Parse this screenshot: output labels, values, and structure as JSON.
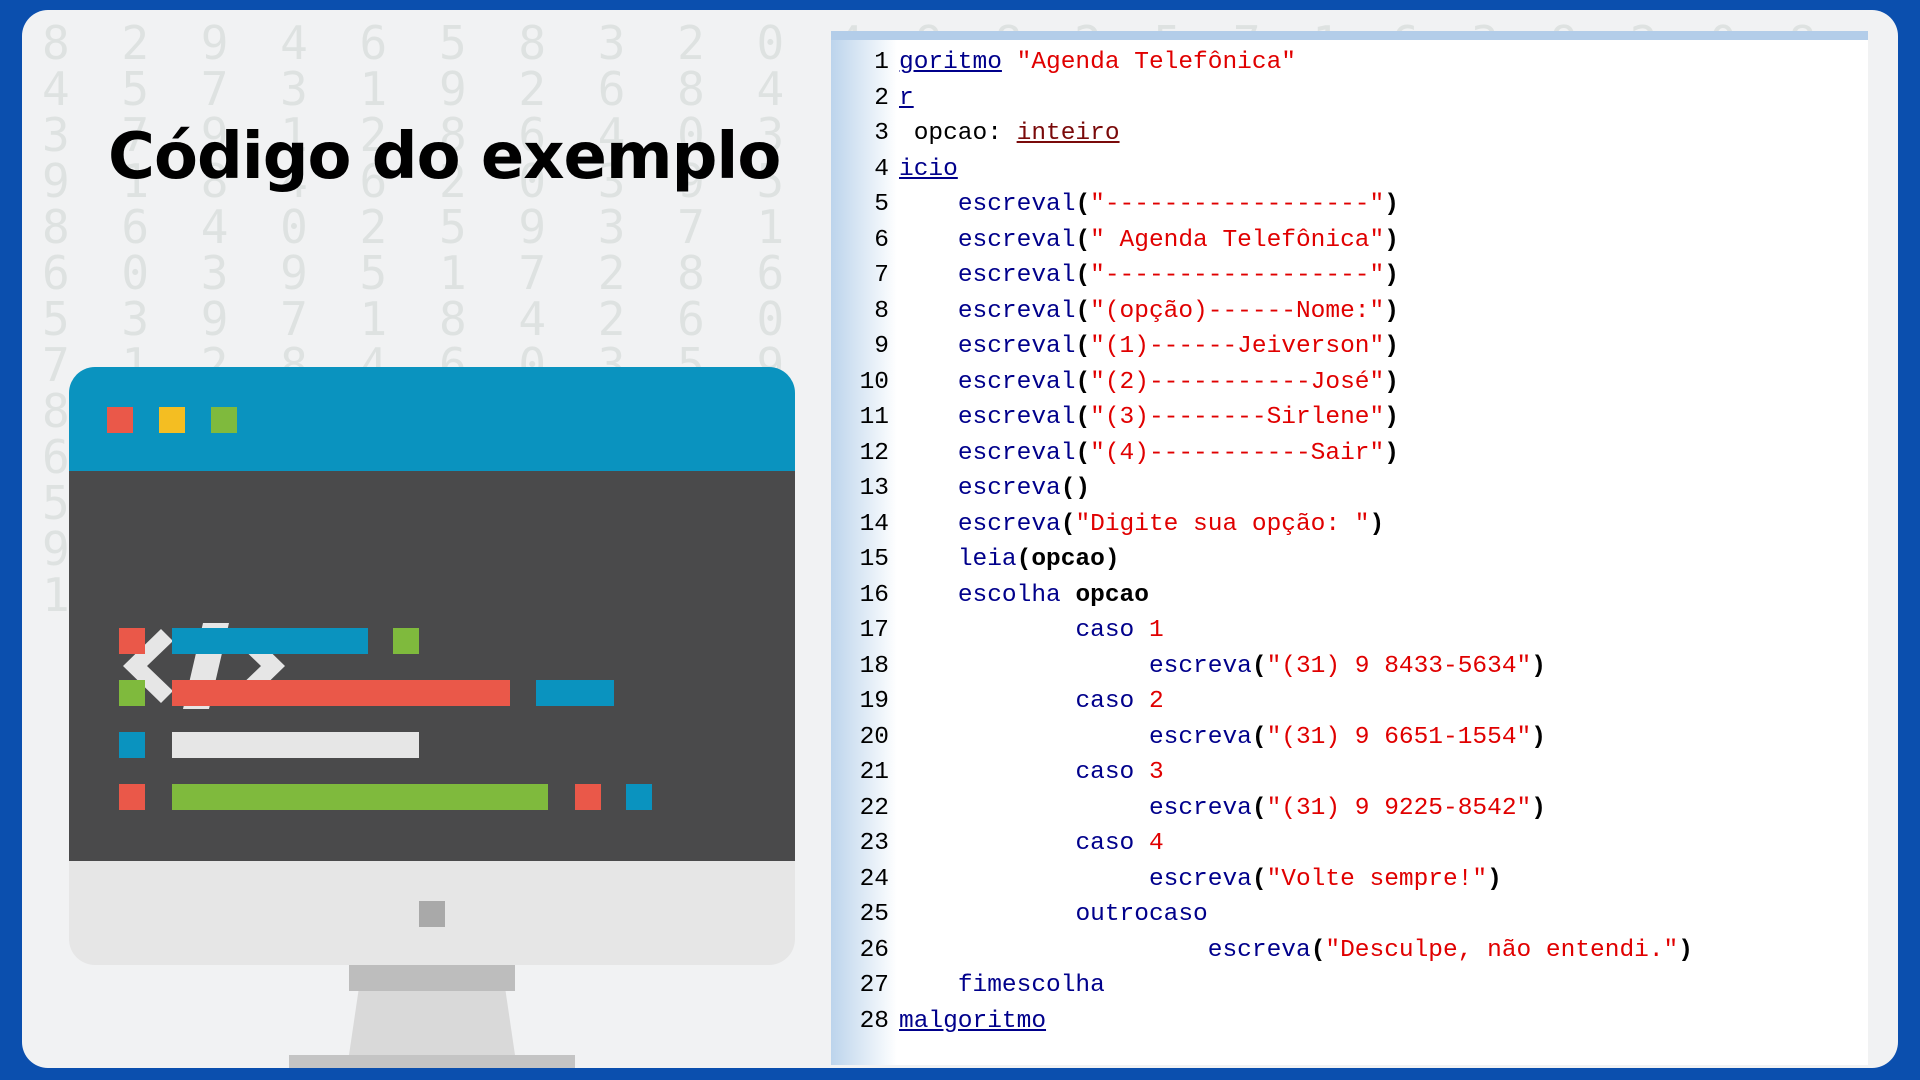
{
  "title": "Código do exemplo",
  "colors": {
    "background": "#0b4fae",
    "card": "#f1f2f3",
    "screen_top": "#0a93bf",
    "screen_body": "#4a4a4b",
    "red": "#ea5849",
    "yellow": "#f4be22",
    "green": "#7fba3d",
    "blue": "#0a93bf",
    "light": "#e6e6e6"
  },
  "icons": [
    "window-red-dot-icon",
    "window-yellow-dot-icon",
    "window-green-dot-icon",
    "code-brackets-icon"
  ],
  "code": {
    "line_numbers": [
      "1",
      "2",
      "3",
      "4",
      "5",
      "6",
      "7",
      "8",
      "9",
      "10",
      "11",
      "12",
      "13",
      "14",
      "15",
      "16",
      "17",
      "18",
      "19",
      "20",
      "21",
      "22",
      "23",
      "24",
      "25",
      "26",
      "27",
      "28"
    ],
    "l1_kw": "goritmo",
    "l1_str": "\"Agenda Telefônica\"",
    "l2_kw": "r",
    "l3_id": "opcao:",
    "l3_type": "inteiro",
    "l4_kw": "icio",
    "fn_escreval": "escreval",
    "fn_escreva": "escreva",
    "fn_leia": "leia",
    "l5_str": "\"------------------\"",
    "l6_str": "\" Agenda Telefônica\"",
    "l7_str": "\"------------------\"",
    "l8_str": "\"(opção)------Nome:\"",
    "l9_str": "\"(1)------Jeiverson\"",
    "l10_str": "\"(2)-----------José\"",
    "l11_str": "\"(3)--------Sirlene\"",
    "l12_str": "\"(4)-----------Sair\"",
    "l14_str": "\"Digite sua opção: \"",
    "l15_arg": "opcao",
    "l16_kw": "escolha",
    "l16_id": "opcao",
    "caso": "caso",
    "l17_num": "1",
    "l19_num": "2",
    "l21_num": "3",
    "l23_num": "4",
    "l18_str": "\"(31) 9 8433-5634\"",
    "l20_str": "\"(31) 9 6651-1554\"",
    "l22_str": "\"(31) 9 9225-8542\"",
    "l24_str": "\"Volte sempre!\"",
    "l25_kw": "outrocaso",
    "l26_str": "\"Desculpe, não entendi.\"",
    "l27_kw": "fimescolha",
    "l28_kw": "malgoritmo"
  }
}
